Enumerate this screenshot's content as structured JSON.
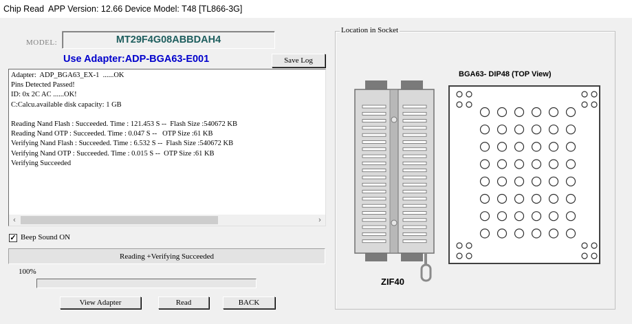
{
  "window": {
    "app_name": "Chip Read",
    "version_info": "APP Version: 12.66 Device Model: T48 [TL866-3G]"
  },
  "model": {
    "label": "MODEL:",
    "value": "MT29F4G08ABBDAH4"
  },
  "adapter_text": "Use Adapter:ADP-BGA63-E001",
  "buttons": {
    "save_log": "Save Log",
    "view_adapter": "View Adapter",
    "read": "Read",
    "back": "BACK"
  },
  "log_lines": [
    "Adapter:  ADP_BGA63_EX-1  ......OK",
    "Pins Detected Passed!",
    "ID: 0x 2C AC ......OK!",
    "C:Calcu.available disk capacity: 1 GB",
    "",
    "Reading Nand Flash : Succeeded. Time : 121.453 S --  Flash Size :540672 KB",
    "Reading Nand OTP : Succeeded. Time : 0.047 S --   OTP Size :61 KB",
    "Verifying Nand Flash : Succeeded. Time : 6.532 S --  Flash Size :540672 KB",
    "Verifying Nand OTP : Succeeded. Time : 0.015 S --  OTP Size :61 KB",
    "Verifying Succeeded"
  ],
  "beep": {
    "label": "Beep Sound ON",
    "checked": true
  },
  "status_text": "Reading +Verifying  Succeeded",
  "progress": {
    "label": "100%",
    "value": 1.0
  },
  "socket": {
    "group_title": "Location in Socket",
    "bga_title": "BGA63- DIP48 (TOP View)",
    "zif_label": "ZIF40"
  },
  "icons": {
    "scroll_left": "chevron-left-icon",
    "scroll_right": "chevron-right-icon",
    "check": "checkmark-icon"
  }
}
